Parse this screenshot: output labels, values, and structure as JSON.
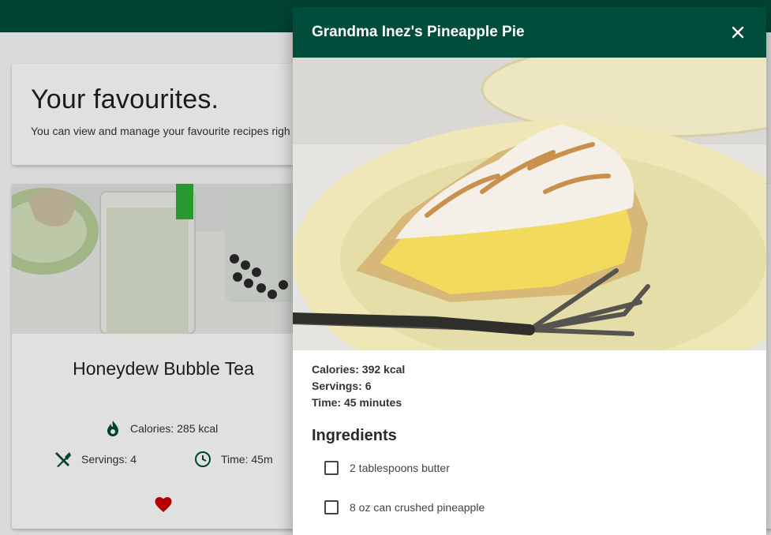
{
  "page": {
    "heading": "Your favourites.",
    "subheading": "You can view and manage your favourite recipes righ"
  },
  "recipe_card": {
    "title": "Honeydew Bubble Tea",
    "calories": "Calories: 285 kcal",
    "servings": "Servings: 4",
    "time": "Time: 45m",
    "favourited": true
  },
  "modal": {
    "title": "Grandma Inez's Pineapple Pie",
    "calories": "Calories: 392 kcal",
    "servings": "Servings: 6",
    "time": "Time: 45 minutes",
    "ingredients_heading": "Ingredients",
    "ingredients": [
      {
        "label": "2 tablespoons butter",
        "checked": false
      },
      {
        "label": "8 oz can crushed pineapple",
        "checked": false
      }
    ]
  },
  "colors": {
    "primary": "#004d3b",
    "heart": "#d10000"
  },
  "icons": [
    "close-icon",
    "fire-icon",
    "utensils-icon",
    "clock-icon",
    "heart-icon"
  ]
}
